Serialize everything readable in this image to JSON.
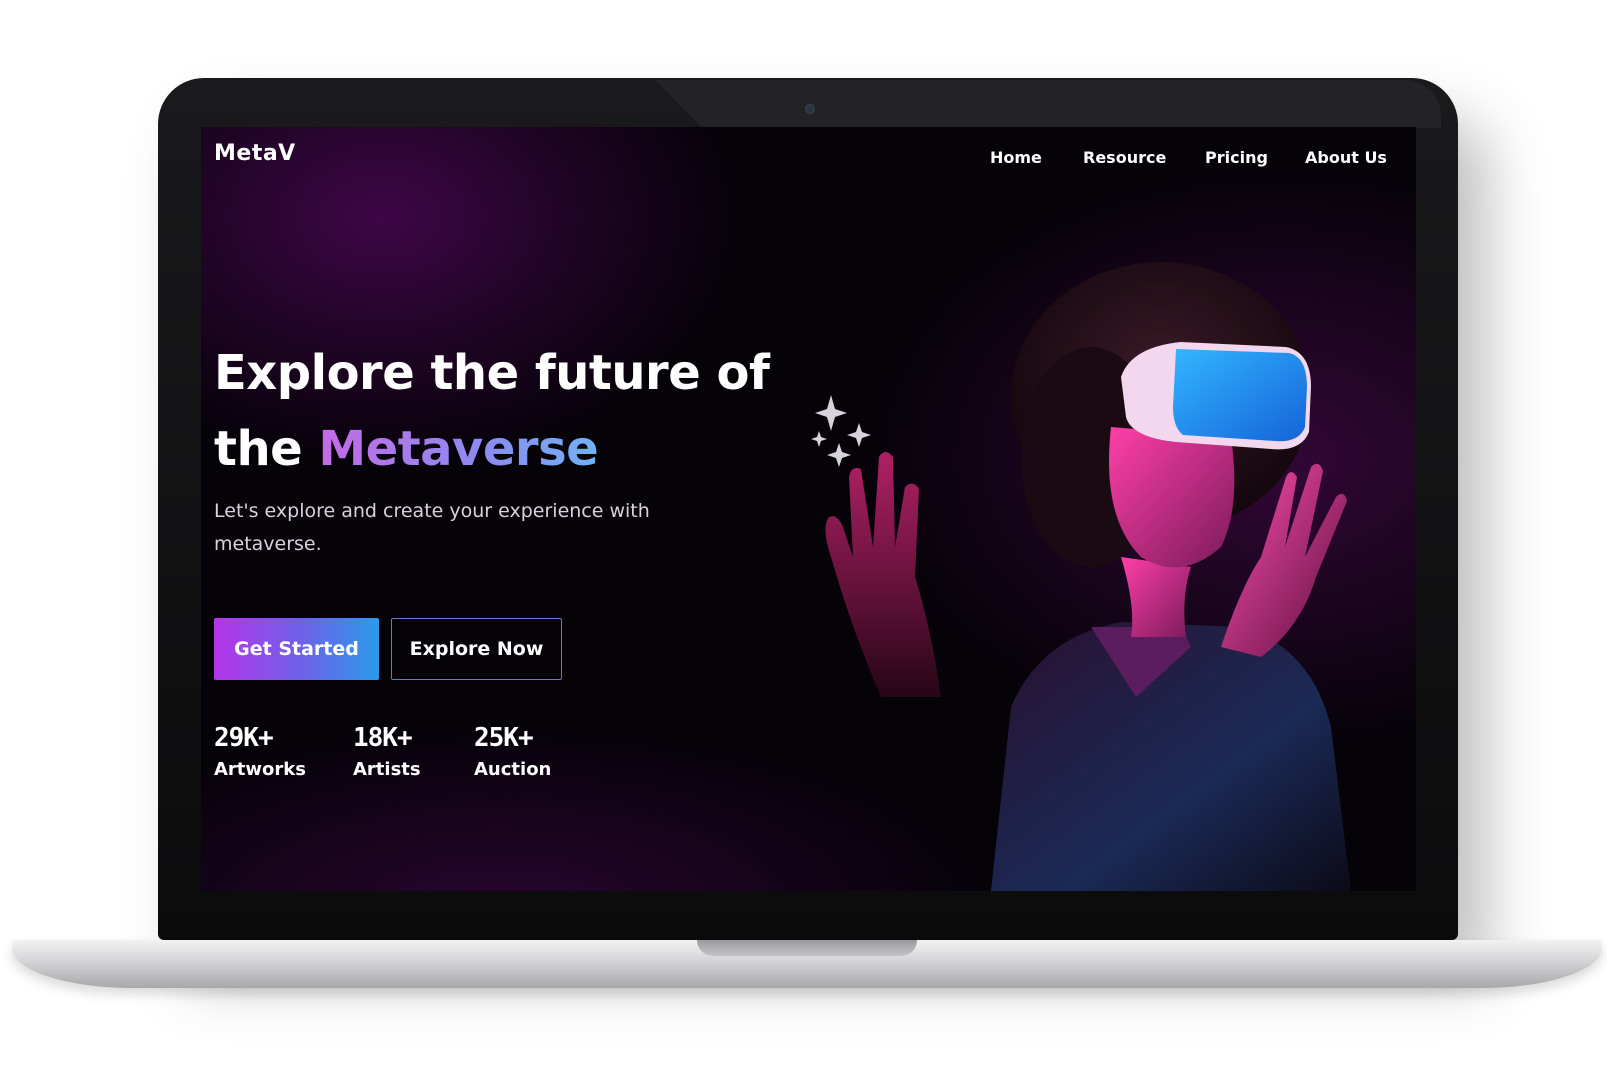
{
  "app": {
    "brand": "MetaV"
  },
  "nav": {
    "items": [
      {
        "label": "Home"
      },
      {
        "label": "Resource"
      },
      {
        "label": "Pricing"
      },
      {
        "label": "About Us"
      }
    ]
  },
  "hero": {
    "headline_line1": "Explore the future of",
    "headline_prefix": "the ",
    "headline_accent": "Metaverse",
    "subtitle": "Let's explore and create your experience with metaverse.",
    "primary_button": "Get Started",
    "secondary_button": "Explore Now",
    "stats": [
      {
        "value": "29K+",
        "label": "Artworks"
      },
      {
        "value": "18K+",
        "label": "Artists"
      },
      {
        "value": "25K+",
        "label": "Auction"
      }
    ]
  },
  "icons": {
    "sparkle": "sparkle-icon",
    "hero_image": "vr-headset-person-image"
  },
  "colors": {
    "background": "#050208",
    "accent_purple": "#b535e8",
    "accent_blue": "#2a9bea",
    "text_primary": "#ffffff",
    "text_secondary": "#d9d2de"
  }
}
